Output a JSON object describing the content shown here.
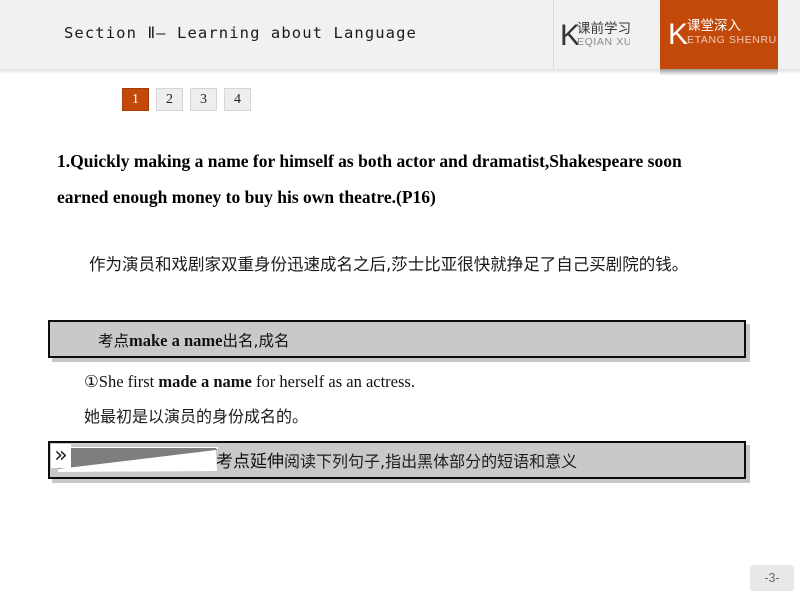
{
  "header": {
    "title": "Section Ⅱ— Learning about Language",
    "tabs": [
      {
        "initial": "K",
        "cn": "课前学习",
        "pinyin": "EQIAN XUEXI",
        "active": false
      },
      {
        "initial": "K",
        "cn": "课堂深入",
        "pinyin": "ETANG SHENRU",
        "active": true
      }
    ]
  },
  "pills": [
    {
      "label": "1",
      "active": true
    },
    {
      "label": "2",
      "active": false
    },
    {
      "label": "3",
      "active": false
    },
    {
      "label": "4",
      "active": false
    }
  ],
  "content": {
    "eng_statement": "1.Quickly making a name for himself as both actor and dramatist,Shakespeare soon earned enough money to buy his own theatre.(P16)",
    "cn_translation": "作为演员和戏剧家双重身份迅速成名之后,莎士比亚很快就挣足了自己买剧院的钱。",
    "keypoint_box": {
      "label_cn": "考点",
      "phrase": "make a name",
      "meaning_cn": "出名,成名"
    },
    "example": {
      "en_prefix": "①She first ",
      "en_bold": "made a name",
      "en_suffix": " for herself as an actress.",
      "cn": "她最初是以演员的身份成名的。"
    },
    "extension_box": {
      "chevron": "»",
      "label_cn": "考点延伸",
      "instruction_cn": "阅读下列句子,指出黑体部分的短语和意义"
    }
  },
  "footer": {
    "page_number": "-3-"
  },
  "colors": {
    "accent_orange": "#c2490a",
    "header_bg": "#f1f1f1",
    "box_fill": "#c9c9c9",
    "box_border": "#0d0d0d",
    "wedge_gray": "#7e7e7e",
    "page_num_bg": "#e8e8e8"
  }
}
